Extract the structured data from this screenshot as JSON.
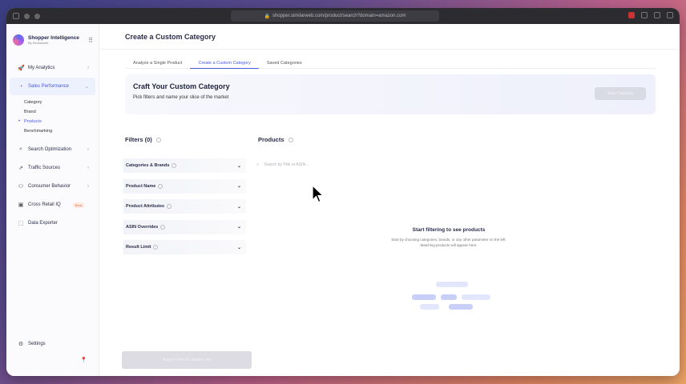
{
  "browser": {
    "url": "shopper.similarweb.com/product/search?domain=amazon.com"
  },
  "brand": {
    "name": "Shopper Intelligence",
    "sub": "By Similarweb"
  },
  "sidebar": {
    "items": [
      {
        "label": "My Analytics",
        "icon": "rocket-icon",
        "chevron": "›"
      },
      {
        "label": "Sales Performance",
        "icon": "chart-icon",
        "chevron": "›"
      },
      {
        "label": "Search Optimization",
        "icon": "search-icon",
        "chevron": "›"
      },
      {
        "label": "Traffic Sources",
        "icon": "traffic-icon",
        "chevron": "›"
      },
      {
        "label": "Consumer Behavior",
        "icon": "people-icon",
        "chevron": "›"
      },
      {
        "label": "Cross Retail IQ",
        "icon": "store-icon",
        "badge": "Beta"
      },
      {
        "label": "Data Exporter",
        "icon": "export-icon"
      }
    ],
    "sub_items": [
      "Category",
      "Brand",
      "Products",
      "Benchmarking"
    ],
    "settings": "Settings"
  },
  "header": {
    "title": "Create a Custom Category"
  },
  "tabs": [
    "Analyze a Single Product",
    "Create a Custom Category",
    "Saved Categories"
  ],
  "hero": {
    "title": "Craft Your Custom Category",
    "subtitle": "Pick filters and name your slice of the market",
    "save_label": "Save Category"
  },
  "filters": {
    "title": "Filters (0)",
    "items": [
      "Categories & Brands",
      "Product Name",
      "Product Attributes",
      "ASIN Overrides",
      "Result Limit"
    ],
    "apply_label": "Apply Filter & Update list"
  },
  "products": {
    "title": "Products",
    "search_placeholder": "Search by Title or ASIN...",
    "empty_title": "Start filtering to see products",
    "empty_desc_1": "Start by choosing categories, brands, or any other parameter on the left.",
    "empty_desc_2": "Matching products will appear here."
  },
  "colors": {
    "accent": "#4a5bd8",
    "active_bg": "#edf0fd",
    "beta": "#e56a4a"
  }
}
